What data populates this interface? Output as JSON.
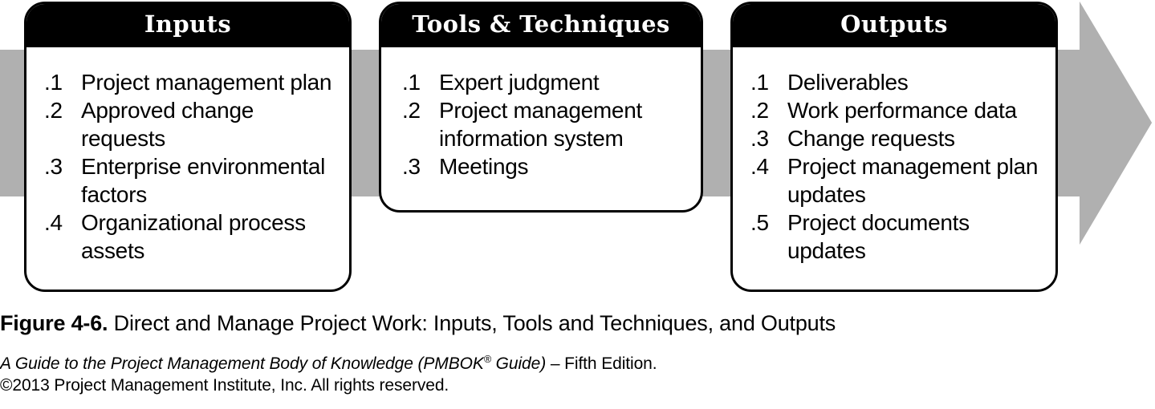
{
  "figure": {
    "arrow_color": "#b0b0b0",
    "header_bg": "#000000",
    "header_fg": "#ffffff",
    "box_border": "#000000"
  },
  "boxes": [
    {
      "id": "inputs",
      "title": "Inputs",
      "items": [
        {
          "num": ".1",
          "text": "Project management plan"
        },
        {
          "num": ".2",
          "text": "Approved change requests"
        },
        {
          "num": ".3",
          "text": "Enterprise environmental factors"
        },
        {
          "num": ".4",
          "text": "Organizational process assets"
        }
      ]
    },
    {
      "id": "tools",
      "title": "Tools & Techniques",
      "items": [
        {
          "num": ".1",
          "text": "Expert judgment"
        },
        {
          "num": ".2",
          "text": "Project management information system"
        },
        {
          "num": ".3",
          "text": "Meetings"
        }
      ]
    },
    {
      "id": "outputs",
      "title": "Outputs",
      "items": [
        {
          "num": ".1",
          "text": "Deliverables"
        },
        {
          "num": ".2",
          "text": "Work performance data"
        },
        {
          "num": ".3",
          "text": "Change requests"
        },
        {
          "num": ".4",
          "text": "Project management plan updates"
        },
        {
          "num": ".5",
          "text": "Project documents updates"
        }
      ]
    }
  ],
  "caption": {
    "figure_label": "Figure 4-6.",
    "figure_text": "Direct and Manage Project Work: Inputs, Tools and Techniques, and Outputs"
  },
  "source": {
    "title_part1": "A Guide to the Project Management Body of Knowledge (PMBOK",
    "registered_mark": "®",
    "title_part2": " Guide)",
    "edition": " – Fifth Edition.",
    "copyright": "©2013 Project Management Institute, Inc. All rights reserved."
  }
}
